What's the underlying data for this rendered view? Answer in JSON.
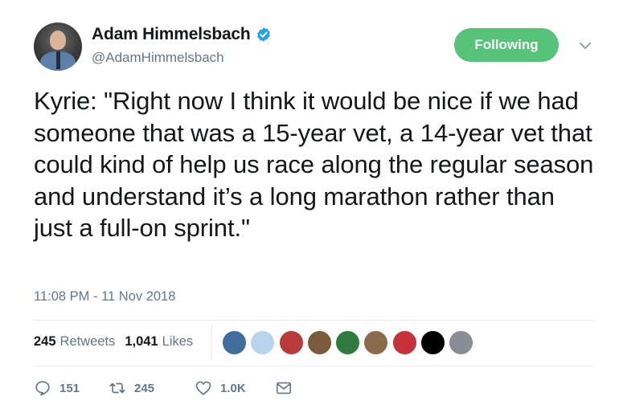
{
  "author": {
    "display_name": "Adam Himmelsbach",
    "handle": "@AdamHimmelsbach",
    "verified": true
  },
  "follow_button": {
    "label": "Following"
  },
  "tweet": {
    "text": "Kyrie: \"Right now I think it would be nice if we had someone that was a 15-year vet, a 14-year vet that could kind of help us race along the regular season and understand it’s a long marathon rather than just a full-on sprint.\"",
    "timestamp": "11:08 PM - 11 Nov 2018"
  },
  "stats": {
    "retweets_count": "245",
    "retweets_label": "Retweets",
    "likes_count": "1,041",
    "likes_label": "Likes"
  },
  "likers": [
    {
      "name": "liker-avatar",
      "color": "#3f6e9e"
    },
    {
      "name": "liker-avatar",
      "color": "#b9d4ea"
    },
    {
      "name": "liker-avatar",
      "color": "#b83a3a"
    },
    {
      "name": "liker-avatar",
      "color": "#7a5a3a"
    },
    {
      "name": "liker-avatar",
      "color": "#2f7a3c"
    },
    {
      "name": "liker-avatar",
      "color": "#8a6a4a"
    },
    {
      "name": "liker-avatar",
      "color": "#c8303a"
    },
    {
      "name": "liker-avatar",
      "color": "#000000"
    },
    {
      "name": "liker-avatar",
      "color": "#8a8d96"
    }
  ],
  "actions": {
    "reply_count": "151",
    "retweet_count": "245",
    "like_count": "1.0K"
  },
  "colors": {
    "follow_green": "#56c27a",
    "verified_blue": "#1da1f2",
    "secondary_text": "#657786"
  }
}
